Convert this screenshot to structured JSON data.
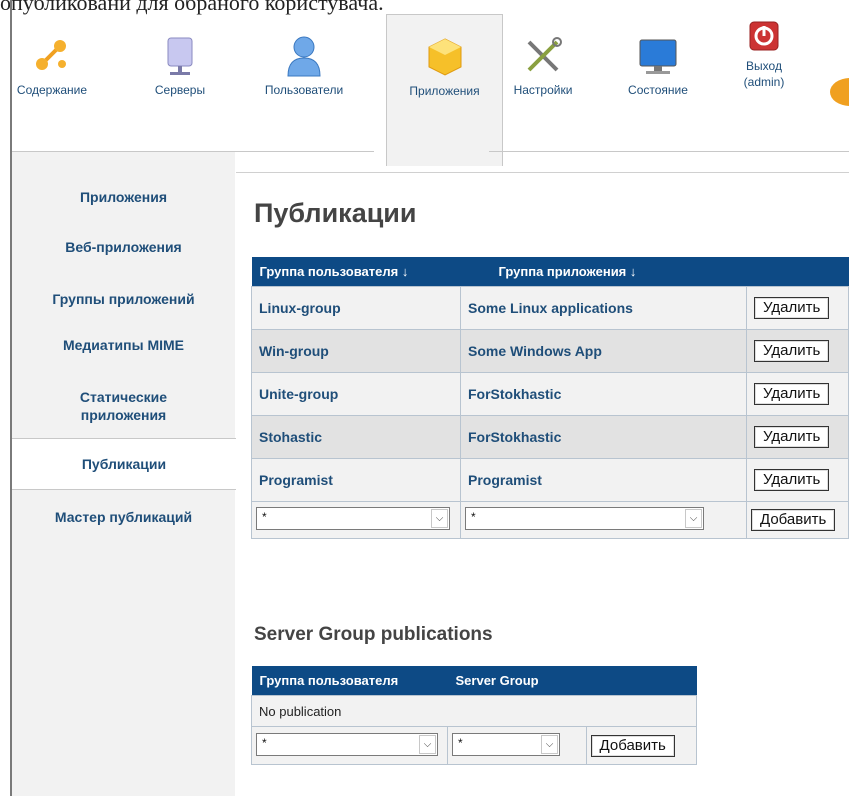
{
  "top_text": "опубликовани для обраного користувача.",
  "toolbar": {
    "items": [
      {
        "label": "Содержание",
        "icon": "content-icon"
      },
      {
        "label": "Серверы",
        "icon": "server-icon"
      },
      {
        "label": "Пользователи",
        "icon": "user-icon"
      },
      {
        "label": "Приложения",
        "icon": "application-icon",
        "active": true
      },
      {
        "label": "Настройки",
        "icon": "tools-icon"
      },
      {
        "label": "Состояние",
        "icon": "monitor-icon"
      },
      {
        "label": "Выход",
        "label2": "(admin)",
        "icon": "power-icon"
      }
    ]
  },
  "leftnav": {
    "items": [
      {
        "label": "Приложения"
      },
      {
        "label": "Веб-приложения"
      },
      {
        "label": "Группы приложений"
      },
      {
        "label": "Медиатипы MIME"
      },
      {
        "label": "Статические",
        "label2": "приложения"
      },
      {
        "label": "Публикации",
        "active": true
      },
      {
        "label": "Мастер публикаций"
      }
    ]
  },
  "publications": {
    "title": "Публикации",
    "headers": {
      "user_group": "Группа пользователя ↓",
      "app_group": "Группа приложения ↓"
    },
    "rows": [
      {
        "user_group": "Linux-group",
        "app_group": "Some Linux applications",
        "action": "Удалить"
      },
      {
        "user_group": "Win-group",
        "app_group": "Some Windows App",
        "action": "Удалить"
      },
      {
        "user_group": "Unite-group",
        "app_group": "ForStokhastic",
        "action": "Удалить"
      },
      {
        "user_group": "Stohastic",
        "app_group": "ForStokhastic",
        "action": "Удалить"
      },
      {
        "user_group": "Programist",
        "app_group": "Programist",
        "action": "Удалить"
      }
    ],
    "add_row": {
      "user_select": "*",
      "app_select": "*",
      "action": "Добавить"
    }
  },
  "server_group": {
    "title": "Server Group publications",
    "headers": {
      "user_group": "Группа пользователя",
      "server_group": "Server Group"
    },
    "empty": "No publication",
    "add_row": {
      "user_select": "*",
      "server_select": "*",
      "action": "Добавить"
    }
  },
  "colors": {
    "header_bg": "#0d4a85",
    "link": "#1f4e79",
    "panel": "#f2f2f2"
  }
}
